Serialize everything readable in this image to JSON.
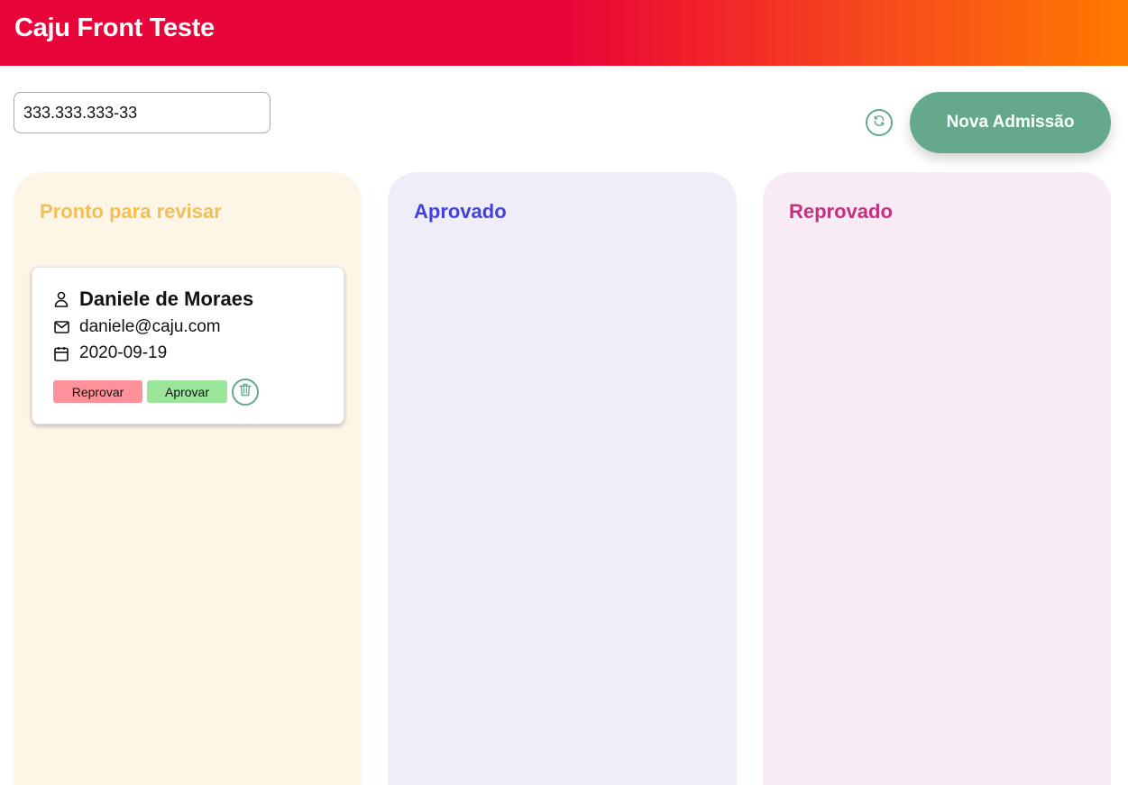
{
  "header": {
    "title": "Caju Front Teste"
  },
  "search": {
    "value": "333.333.333-33"
  },
  "actions": {
    "new_admission_label": "Nova Admissão",
    "refresh_icon": "refresh-icon"
  },
  "columns": [
    {
      "title": "Pronto para revisar",
      "color": "#efc05a",
      "background": "#fdf5e6",
      "cards": [
        {
          "name": "Daniele de Moraes",
          "email": "daniele@caju.com",
          "date": "2020-09-19",
          "reject_label": "Reprovar",
          "approve_label": "Aprovar"
        }
      ]
    },
    {
      "title": "Aprovado",
      "color": "#4242d8",
      "background": "#eeedf9",
      "cards": []
    },
    {
      "title": "Reprovado",
      "color": "#c2307f",
      "background": "#f9ebf4",
      "cards": []
    }
  ],
  "colors": {
    "header_gradient_start": "#e80539",
    "header_gradient_end": "#ff7a00",
    "accent": "#64a98c",
    "reject": "#ff919a",
    "approve": "#9be59b"
  }
}
